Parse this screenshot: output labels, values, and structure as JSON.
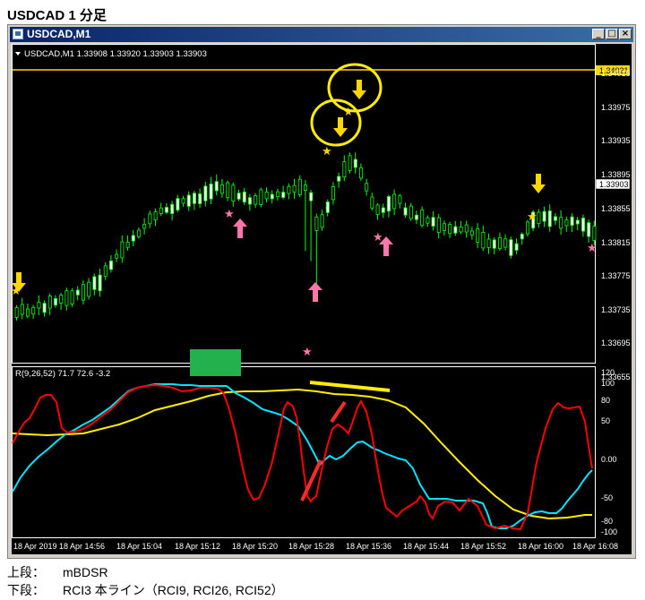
{
  "page": {
    "title": "USDCAD 1 分足"
  },
  "window": {
    "title": "USDCAD,M1",
    "buttons": {
      "minimize": "_",
      "maximize": "□",
      "close": "×"
    }
  },
  "price_panel": {
    "info": "USDCAD,M1  1.33908 1.33920 1.33903 1.33903",
    "y_ticks": [
      "1.34015",
      "1.33975",
      "1.33935",
      "1.33895",
      "1.33855",
      "1.33815",
      "1.33775",
      "1.33735",
      "1.33695",
      "1.33655"
    ],
    "hline_label": "1.34021",
    "current_label": "1.33903",
    "colors": {
      "candle": "#ffffff",
      "wick": "#00ff00",
      "hline": "#ffd700",
      "up_arrow": "#ff77aa",
      "down_arrow": "#ffd700"
    }
  },
  "rci_panel": {
    "info": "R(9,26,52) 71.7 72.6 -3.2",
    "y_ticks": [
      "120",
      "100",
      "80",
      "50",
      "0.00",
      "-50",
      "-80",
      "-100"
    ],
    "colors": {
      "rci9": "#ff0000",
      "rci26": "#00e5ff",
      "rci52": "#ffee00"
    }
  },
  "x_axis": {
    "labels": [
      "18 Apr 2019",
      "18 Apr 14:56",
      "18 Apr 15:04",
      "18 Apr 15:12",
      "18 Apr 15:20",
      "18 Apr 15:28",
      "18 Apr 15:36",
      "18 Apr 15:44",
      "18 Apr 15:52",
      "18 Apr 16:00",
      "18 Apr 16:08"
    ]
  },
  "captions": [
    {
      "label": "上段：",
      "text": "mBDSR"
    },
    {
      "label": "下段：",
      "text": "RCI3 本ライン（RCI9, RCI26, RCI52）"
    }
  ]
}
